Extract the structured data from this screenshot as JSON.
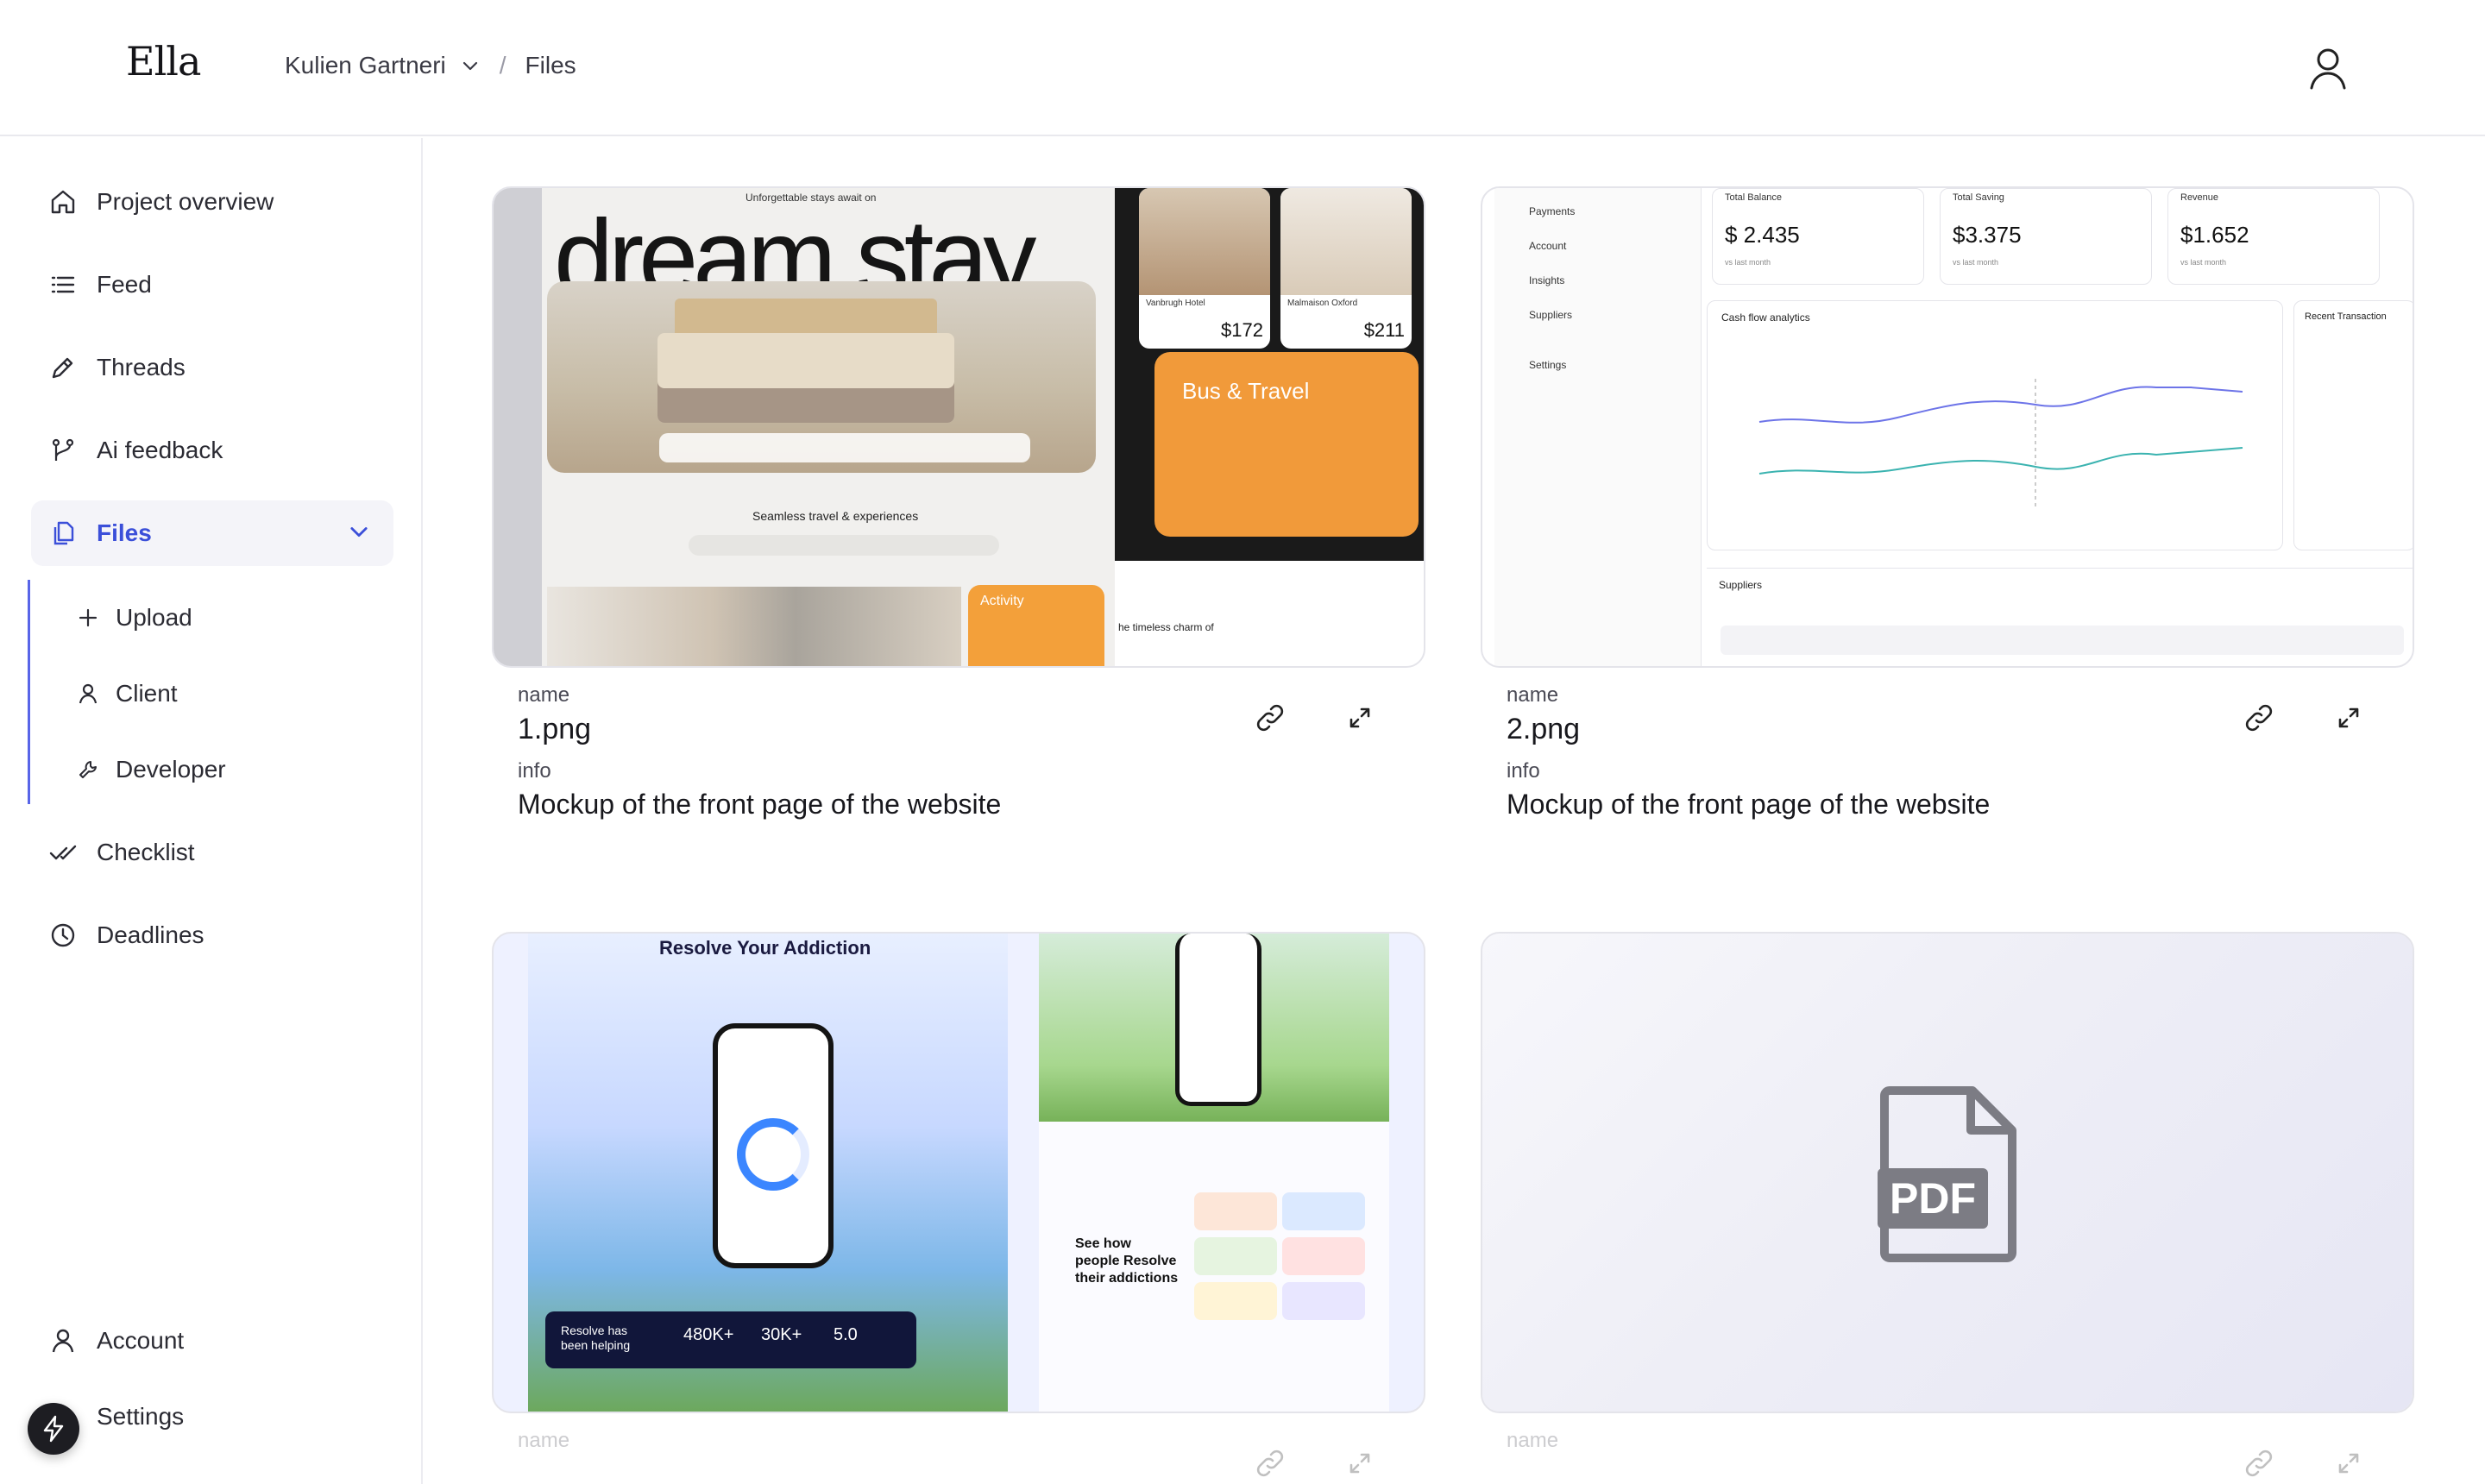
{
  "app": {
    "logo": "Ella"
  },
  "breadcrumb": {
    "project": "Kulien Gartneri",
    "separator": "/",
    "current": "Files"
  },
  "sidebar": {
    "items": [
      {
        "label": "Project overview",
        "icon": "home-icon"
      },
      {
        "label": "Feed",
        "icon": "list-icon"
      },
      {
        "label": "Threads",
        "icon": "pencil-icon"
      },
      {
        "label": "Ai feedback",
        "icon": "branch-icon"
      },
      {
        "label": "Files",
        "icon": "files-icon",
        "active": true
      }
    ],
    "files_sub": [
      {
        "label": "Upload",
        "icon": "plus-icon"
      },
      {
        "label": "Client",
        "icon": "user-icon"
      },
      {
        "label": "Developer",
        "icon": "wrench-icon"
      }
    ],
    "items_after": [
      {
        "label": "Checklist",
        "icon": "check-icon"
      },
      {
        "label": "Deadlines",
        "icon": "clock-icon"
      }
    ],
    "bottom": [
      {
        "label": "Account",
        "icon": "user-icon"
      },
      {
        "label": "Settings",
        "icon": "gear-icon"
      }
    ]
  },
  "files": [
    {
      "name_label": "name",
      "name": "1.png",
      "info_label": "info",
      "info": "Mockup of the front page of the website"
    },
    {
      "name_label": "name",
      "name": "2.png",
      "info_label": "info",
      "info": "Mockup of the front page of the website"
    },
    {
      "name_label": "name",
      "name": ""
    },
    {
      "name_label": "name",
      "name": ""
    }
  ],
  "mockup1": {
    "tagline": "Unforgettable stays await on",
    "hero": "dream stay",
    "section": "Seamless travel & experiences",
    "activity": "Activity",
    "hotel1": "Vanbrugh Hotel",
    "price1": "$172",
    "hotel2": "Malmaison Oxford",
    "price2": "$211",
    "bus": "Bus & Travel",
    "charm": "he timeless charm of"
  },
  "mockup2": {
    "nav": [
      "Payments",
      "Account",
      "Insights",
      "Suppliers",
      "Settings"
    ],
    "stats": [
      {
        "label": "Total Balance",
        "value": "$ 2.435",
        "sub": "vs last month"
      },
      {
        "label": "Total Saving",
        "value": "$3.375",
        "sub": "vs last month"
      },
      {
        "label": "Revenue",
        "value": "$1.652",
        "sub": "vs last month"
      }
    ],
    "chart_title": "Cash flow analytics",
    "transactions": "Recent Transaction",
    "suppliers": "Suppliers"
  },
  "mockup3": {
    "title": "Resolve Your Addiction",
    "bar_text": "Resolve has been helping",
    "stat1": "480K+",
    "stat2": "30K+",
    "stat3": "5.0",
    "see_how": "See how people Resolve their addictions"
  },
  "pdf_label": "PDF",
  "colors": {
    "accent": "#3b4fd9",
    "sub_line": "#5865e8",
    "orange": "#f19a3a"
  }
}
